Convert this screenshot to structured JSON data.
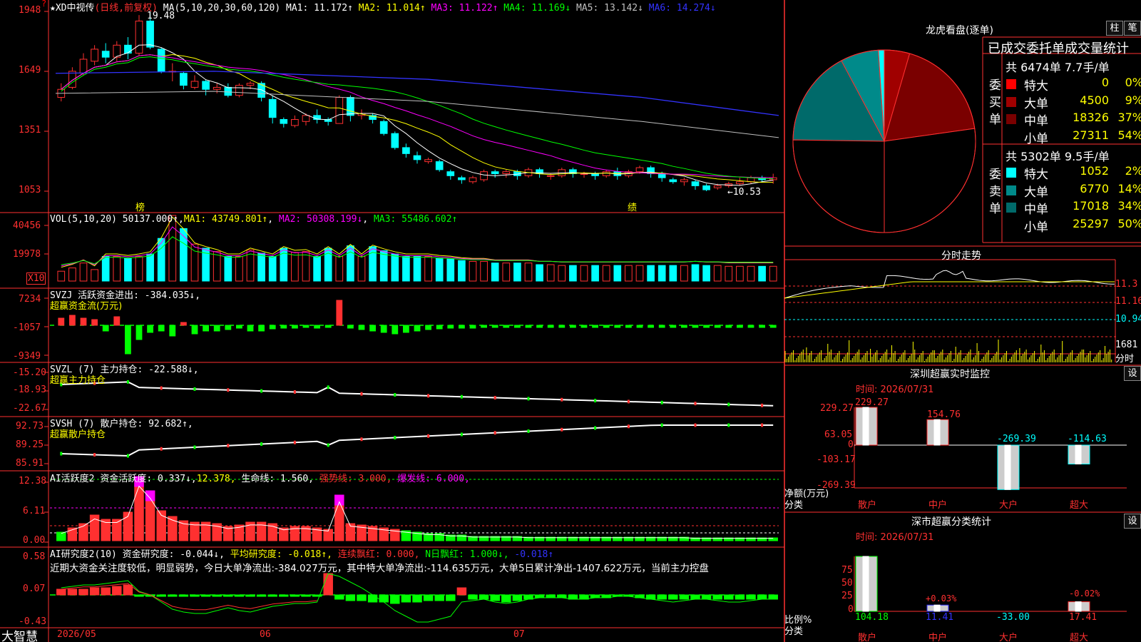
{
  "main": {
    "title": "★XD中视传",
    "mode": "(日线,前复权)",
    "ma_label": "MA(5,10,20,30,60,120)",
    "ma": [
      {
        "label": "MA1: 11.172↑",
        "color": "#ffffff"
      },
      {
        "label": "MA2: 11.014↑",
        "color": "#ffff00"
      },
      {
        "label": "MA3: 11.122↑",
        "color": "#ff00ff"
      },
      {
        "label": "MA4: 11.169↓",
        "color": "#00ff00"
      },
      {
        "label": "MA5: 13.142↓",
        "color": "#c0c0c0"
      },
      {
        "label": "MA6: 14.274↓",
        "color": "#3333ff"
      }
    ],
    "y_ticks": [
      "1948",
      "1649",
      "1351",
      "1053"
    ],
    "high_label": "19.48",
    "low_label": "←10.53",
    "mark_bang": "榜",
    "mark_ji": "绩",
    "corner_q": "?"
  },
  "vol": {
    "title": "VOL(5,10,20)",
    "value": "50137.000↑",
    "ma1": "MA1: 43749.801↑",
    "ma2": "MA2: 50308.199↓",
    "ma3": "MA3: 55486.602↑",
    "y_ticks": [
      "40456",
      "19978"
    ],
    "x10": "X10"
  },
  "svzj": {
    "title": "SVZJ",
    "label": "活跃资金进出: -384.035↓,",
    "sub": "超赢资金流(万元)",
    "y_ticks": [
      "7234",
      "-1057",
      "-9349"
    ]
  },
  "svzl": {
    "title": "SVZL (7)",
    "label": "主力持仓: -22.588↓,",
    "sub": "超赢主力持仓",
    "y_ticks": [
      "-15.20",
      "-18.93",
      "-22.67"
    ]
  },
  "svsh": {
    "title": "SVSH (7)",
    "label": "散户持仓: 92.682↑,",
    "sub": "超赢散户持仓",
    "y_ticks": [
      "92.73",
      "89.25",
      "85.91"
    ]
  },
  "ai1": {
    "title": "AI活跃度2",
    "label": "资金活跃度: 0.337↓,",
    "v2": "12.378,",
    "life": "生命线: 1.560,",
    "strong": "强势线: 3.000,",
    "burst": "爆发线: 6.000,",
    "y_ticks": [
      "12.38",
      "6.11",
      "0.00"
    ]
  },
  "ai2": {
    "title": "AI研究度2(10)",
    "label": "资金研究度: -0.044↓,",
    "avg": "平均研究度: -0.018↑,",
    "cont": "连续飘红: 0.000,",
    "nday": "N日飘红: 1.000↓,",
    "last": "-0.018↑",
    "text": "近期大资金关注度较低，明显弱势，今日大单净流出:-384.027万元，其中特大单净流出:-114.635万元，大单5日累计净出-1407.622万元，当前主力控盘",
    "y_ticks": [
      "0.58",
      "0.07",
      "-0.43"
    ]
  },
  "bottom": {
    "brand": "大智慧",
    "dates": [
      "2026/05",
      "06",
      "07"
    ]
  },
  "right": {
    "btn_zhu": "柱",
    "btn_bi": "笔",
    "lhb_title": "龙虎看盘(逐单)",
    "stat_title": "已成交委托单成交量统计",
    "buy": {
      "label": "委买单",
      "total": "共 6474单 7.7手/单",
      "rows": [
        {
          "name": "特大",
          "vol": "0",
          "pct": "0%",
          "color": "#ff0000"
        },
        {
          "name": "大单",
          "vol": "4500",
          "pct": "9%",
          "color": "#a00000"
        },
        {
          "name": "中单",
          "vol": "18326",
          "pct": "37%",
          "color": "#7a0000"
        },
        {
          "name": "小单",
          "vol": "27311",
          "pct": "54%",
          "color": "#000000"
        }
      ]
    },
    "sell": {
      "label": "委卖单",
      "total": "共 5302单 9.5手/单",
      "rows": [
        {
          "name": "特大",
          "vol": "1052",
          "pct": "2%",
          "color": "#00ffff"
        },
        {
          "name": "大单",
          "vol": "6770",
          "pct": "14%",
          "color": "#008a8a"
        },
        {
          "name": "中单",
          "vol": "17018",
          "pct": "34%",
          "color": "#006a6a"
        },
        {
          "name": "小单",
          "vol": "25297",
          "pct": "50%",
          "color": "#000000"
        }
      ]
    },
    "fs_title": "分时走势",
    "fs_ticks": [
      "11.3",
      "11.16",
      "10.94"
    ],
    "fs_vol": "1681",
    "fs_unit": "分时",
    "sz_title": "深圳超赢实时监控",
    "sz_set": "设",
    "sz_time": "时间: 2026/07/31",
    "sz_ticks": [
      "229.27",
      "63.05",
      "0",
      "-103.17",
      "-269.39"
    ],
    "sz_values": [
      "229.27",
      "154.76",
      "-269.39",
      "-114.63"
    ],
    "sz_unit": "净额(万元)",
    "sz_cat_label": "分类",
    "cats": [
      "散户",
      "中户",
      "大户",
      "超大"
    ],
    "cls_title": "深市超赢分类统计",
    "cls_set": "设",
    "cls_time": "时间: 2026/07/31",
    "cls_ticks": [
      "75",
      "50",
      "25",
      "0"
    ],
    "cls_values": [
      "104.18",
      "11.41",
      "-33.00",
      "17.41"
    ],
    "cls_small": [
      "+0.03%",
      "-0.02%"
    ],
    "cls_unit": "比例%",
    "cls_cat_label": "分类"
  },
  "chart_data": [
    {
      "type": "pie",
      "title": "龙虎看盘(逐单)",
      "categories": [
        "委买特大",
        "委买大单",
        "委买中单",
        "委买小单",
        "委卖特大",
        "委卖大单",
        "委卖中单",
        "委卖小单"
      ],
      "values": [
        0,
        4500,
        18326,
        27311,
        1052,
        6770,
        17018,
        25297
      ]
    },
    {
      "type": "bar",
      "title": "深圳超赢实时监控",
      "categories": [
        "散户",
        "中户",
        "大户",
        "超大"
      ],
      "values": [
        229.27,
        154.76,
        -269.39,
        -114.63
      ],
      "ylabel": "净额(万元)",
      "ylim": [
        -269.39,
        229.27
      ]
    },
    {
      "type": "bar",
      "title": "深市超赢分类统计",
      "categories": [
        "散户",
        "中户",
        "大户",
        "超大"
      ],
      "values": [
        104.18,
        11.41,
        -33.0,
        17.41
      ],
      "ylabel": "比例%",
      "ylim": [
        0,
        100
      ]
    }
  ]
}
